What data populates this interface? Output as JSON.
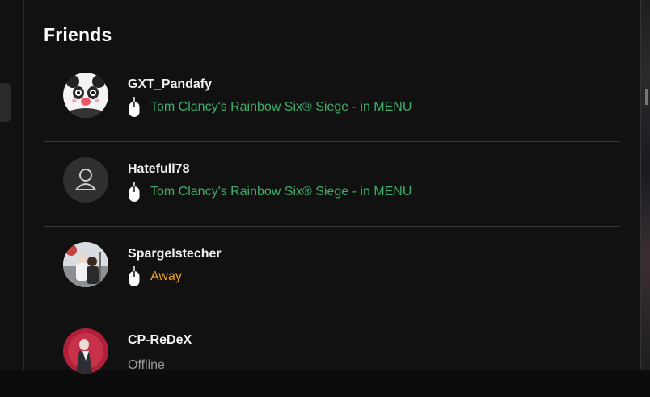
{
  "section": {
    "title": "Friends"
  },
  "friends": [
    {
      "name": "GXT_Pandafy",
      "status": "Tom Clancy's Rainbow Six® Siege - in MENU",
      "status_kind": "in-game",
      "status_color": "#3fae6a",
      "avatar": "panda-avatar"
    },
    {
      "name": "Hatefull78",
      "status": "Tom Clancy's Rainbow Six® Siege - in MENU",
      "status_kind": "in-game",
      "status_color": "#3fae6a",
      "avatar": "default-user-avatar"
    },
    {
      "name": "Spargelstecher",
      "status": "Away",
      "status_kind": "away",
      "status_color": "#e8a12a",
      "avatar": "photo-avatar"
    },
    {
      "name": "CP-ReDeX",
      "status": "Offline",
      "status_kind": "offline",
      "status_color": "#9a9a9a",
      "avatar": "character-avatar"
    }
  ],
  "colors": {
    "background": "#111111",
    "text": "#f2f2f2",
    "divider": "#3a3a3a"
  },
  "icons": {
    "platform": "mouse-icon"
  }
}
